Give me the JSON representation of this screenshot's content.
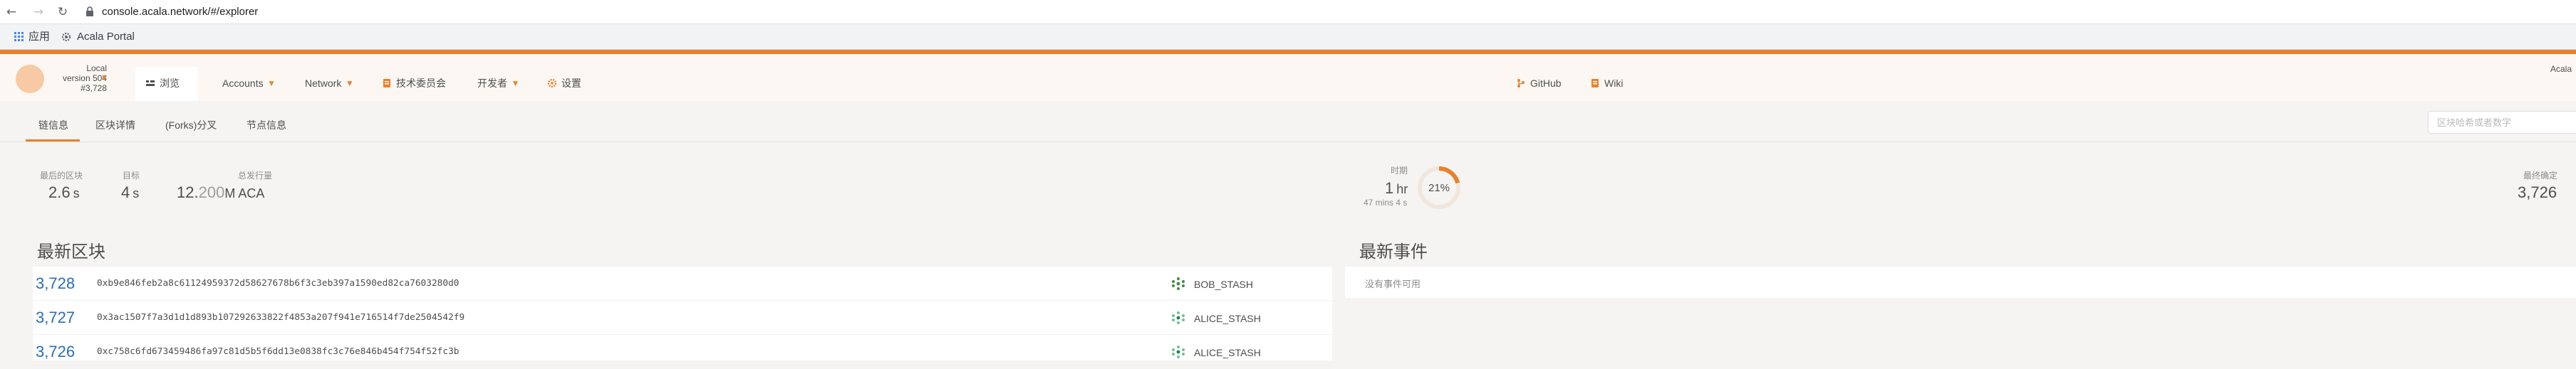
{
  "browser": {
    "back_icon": "arrow-left-icon",
    "forward_icon": "arrow-right-icon",
    "reload_icon": "reload-icon",
    "url": "console.acala.network/#/explorer",
    "bookmarks": [
      {
        "label": "应用",
        "icon": "apps-grid-icon"
      },
      {
        "label": "Acala Portal",
        "icon": "gear-icon"
      }
    ]
  },
  "header": {
    "chain_name": "Local",
    "version": "version 504",
    "block": "#3,728",
    "corner_label": "Acala",
    "menu": [
      {
        "label": "浏览",
        "icon": "explorer-icon",
        "active": true
      },
      {
        "label": "Accounts",
        "dropdown": true
      },
      {
        "label": "Network",
        "dropdown": true
      },
      {
        "label": "技术委员会",
        "icon": "council-icon"
      },
      {
        "label": "开发者",
        "dropdown": true
      },
      {
        "label": "设置",
        "icon": "settings-icon"
      },
      {
        "label": "GitHub",
        "icon": "github-icon"
      },
      {
        "label": "Wiki",
        "icon": "wiki-icon"
      }
    ],
    "accent_color": "#e8812e"
  },
  "subnav": {
    "tabs": [
      "链信息",
      "区块详情",
      "(Forks)分叉",
      "节点信息"
    ],
    "active_tab": "链信息",
    "search_placeholder": "区块哈希或者数字"
  },
  "summary": {
    "last_block": {
      "label": "最后的区块",
      "value": "2.6",
      "unit": "s"
    },
    "target": {
      "label": "目标",
      "value": "4",
      "unit": "s"
    },
    "total_issuance": {
      "label": "总发行量",
      "value": "12.",
      "faded": "200",
      "unit": "M ACA"
    },
    "era": {
      "label": "时期",
      "value": "1",
      "unit": "hr",
      "sub": "47 mins 4 s",
      "progress_text": "21%",
      "progress": 0.21
    },
    "finalized": {
      "label": "最终确定",
      "value": "3,726"
    }
  },
  "recent_blocks": {
    "title": "最新区块",
    "rows": [
      {
        "number": "3,728",
        "hash": "0xb9e846feb2a8c61124959372d58627678b6f3c3eb397a1590ed82ca7603280d0",
        "author": "BOB_STASH",
        "author_icon": "identicon-icon",
        "identicon_color": "#3e8b40"
      },
      {
        "number": "3,727",
        "hash": "0x3ac1507f7a3d1d1d893b107292633822f4853a207f941e716514f7de2504542f9",
        "author": "ALICE_STASH",
        "author_icon": "identicon-icon",
        "identicon_color": "#6cc291"
      },
      {
        "number": "3,726",
        "hash": "0xc758c6fd673459486fa97c81d5b5f6dd13e0838fc3c76e846b454f754f52fc3b",
        "author": "ALICE_STASH",
        "author_icon": "identicon-icon",
        "identicon_color": "#6cc291"
      }
    ]
  },
  "recent_events": {
    "title": "最新事件",
    "empty_text": "没有事件可用"
  }
}
